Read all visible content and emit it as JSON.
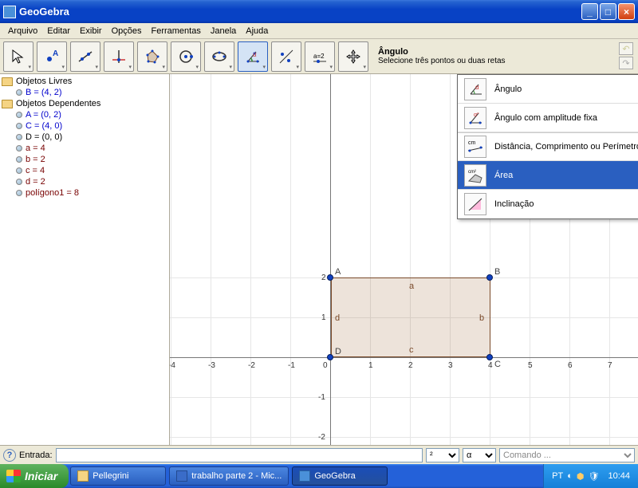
{
  "window": {
    "title": "GeoGebra"
  },
  "menu": {
    "items": [
      "Arquivo",
      "Editar",
      "Exibir",
      "Opções",
      "Ferramentas",
      "Janela",
      "Ajuda"
    ]
  },
  "toolbar": {
    "help_name": "Ângulo",
    "help_hint": "Selecione três pontos ou duas retas"
  },
  "sidebar": {
    "folder_free": "Objetos Livres",
    "folder_dep": "Objetos Dependentes",
    "items_free": [
      {
        "label": "B = (4, 2)",
        "class": "blue"
      }
    ],
    "items_dep": [
      {
        "label": "A = (0, 2)",
        "class": "blue"
      },
      {
        "label": "C = (4, 0)",
        "class": "blue"
      },
      {
        "label": "D = (0, 0)",
        "class": "black"
      },
      {
        "label": "a = 4",
        "class": "darkred"
      },
      {
        "label": "b = 2",
        "class": "darkred"
      },
      {
        "label": "c = 4",
        "class": "darkred"
      },
      {
        "label": "d = 2",
        "class": "darkred"
      },
      {
        "label": "polígono1 = 8",
        "class": "darkred"
      }
    ]
  },
  "dropdown": {
    "items": [
      {
        "label": "Ângulo"
      },
      {
        "label": "Ângulo com amplitude fixa"
      },
      {
        "label": "Distância, Comprimento ou Perímetro"
      },
      {
        "label": "Área"
      },
      {
        "label": "Inclinação"
      }
    ]
  },
  "canvas": {
    "points": {
      "A": "A",
      "B": "B",
      "C": "C",
      "D": "D"
    },
    "edges": {
      "a": "a",
      "b": "b",
      "c": "c",
      "d": "d"
    },
    "xticks": [
      "-4",
      "-3",
      "-2",
      "-1",
      "0",
      "1",
      "2",
      "3",
      "4",
      "5",
      "6",
      "7"
    ],
    "yticks_pos": [
      "1",
      "2"
    ],
    "yticks_neg": [
      "-1",
      "-2"
    ]
  },
  "inputbar": {
    "label": "Entrada:",
    "sel_exp": "²",
    "sel_alpha": "α",
    "cmd_placeholder": "Comando ..."
  },
  "taskbar": {
    "start": "Iniciar",
    "tasks": [
      {
        "label": "Pellegrini"
      },
      {
        "label": "trabalho parte 2 - Mic..."
      },
      {
        "label": "GeoGebra"
      }
    ],
    "lang": "PT",
    "clock": "10:44"
  }
}
